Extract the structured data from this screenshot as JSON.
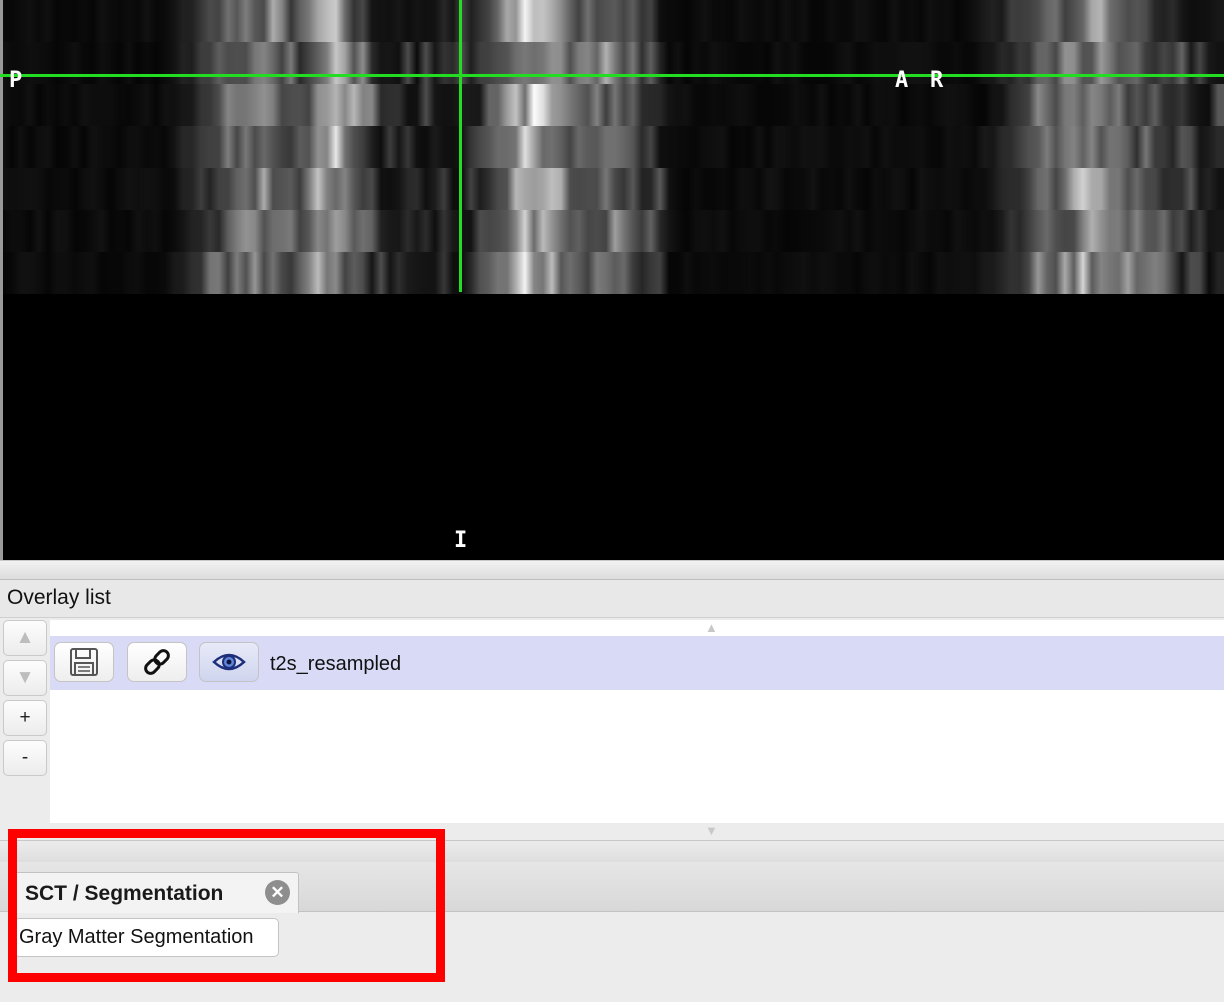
{
  "viewer": {
    "orientation_labels": {
      "left": "P",
      "right_a": "A",
      "right_r": "R",
      "bottom": "I"
    },
    "crosshair_color": "#22dd22"
  },
  "overlay_panel": {
    "title": "Overlay list",
    "side_buttons": {
      "up": "▲",
      "down": "▼",
      "add": "+",
      "remove": "-"
    },
    "items": [
      {
        "name": "t2s_resampled",
        "selected": true
      }
    ],
    "icons": [
      "save-icon",
      "link-icon",
      "eye-icon"
    ]
  },
  "plugin_panel": {
    "tab_label": "SCT / Segmentation",
    "close_symbol": "✕",
    "button_label": "Gray Matter Segmentation",
    "highlight_color": "#ff0000"
  }
}
